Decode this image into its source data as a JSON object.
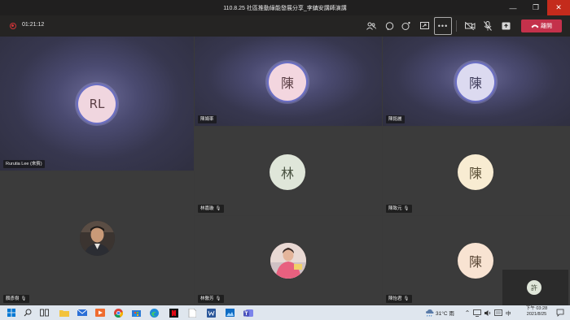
{
  "window": {
    "title": "110.8.25 社區推動綠能發展分享_李鎮安講師演講",
    "minimize": "—",
    "maximize": "❐",
    "close": "✕"
  },
  "toolbar": {
    "recording_time": "01:21:12",
    "leave_label": "離開",
    "icons": [
      "people-icon",
      "chat-icon",
      "reactions-icon",
      "share-screen-icon",
      "more-icon",
      "camera-off-icon",
      "mic-off-icon",
      "share-tray-icon",
      "phone-icon"
    ],
    "leave_color": "#c4314b"
  },
  "participants": [
    {
      "id": "rurutia",
      "name": "Rurutia Lee (來賓)",
      "initials": "RL",
      "avatar_bg": "#f0d6df",
      "text_color": "#5b3f45",
      "ring": true,
      "glow": true,
      "muted": false
    },
    {
      "id": "chen1",
      "name": "陳娟峯",
      "initials": "陳",
      "avatar_bg": "#f3d6df",
      "text_color": "#5b3f45",
      "ring": true,
      "glow": true,
      "muted": false
    },
    {
      "id": "chen2",
      "name": "陳銘麗",
      "initials": "陳",
      "avatar_bg": "#dcdaf0",
      "text_color": "#3f3d5b",
      "ring": true,
      "glow": true,
      "muted": false
    },
    {
      "id": "lin",
      "name": "林嘉璇",
      "initials": "林",
      "avatar_bg": "#dfe6d9",
      "text_color": "#47503f",
      "ring": false,
      "glow": false,
      "muted": true
    },
    {
      "id": "chen3",
      "name": "陳致元",
      "initials": "陳",
      "avatar_bg": "#f8ecd2",
      "text_color": "#5a4f36",
      "ring": false,
      "glow": false,
      "muted": true
    },
    {
      "id": "yan",
      "name": "顏彥樹",
      "initials": "",
      "avatar_bg": "#2a2a2a",
      "text_color": "#fff",
      "ring": false,
      "glow": false,
      "muted": true
    },
    {
      "id": "lin2",
      "name": "林醫芳",
      "initials": "",
      "avatar_bg": "#d9a6b0",
      "text_color": "#fff",
      "ring": false,
      "glow": false,
      "muted": true
    },
    {
      "id": "chen4",
      "name": "陳怡君",
      "initials": "陳",
      "avatar_bg": "#f8e3d2",
      "text_color": "#5a4736",
      "ring": false,
      "glow": false,
      "muted": true
    }
  ],
  "self_view": {
    "initials": "許",
    "avatar_bg": "#dfe6d9"
  },
  "taskbar": {
    "icons": [
      "windows-start-icon",
      "search-icon",
      "task-view-icon",
      "folder-icon",
      "mail-icon",
      "media-icon",
      "chrome-icon",
      "store-icon",
      "edge-icon",
      "netflix-icon",
      "word-icon",
      "photos-icon",
      "teams-icon"
    ],
    "weather": "31°C 雨",
    "ime": "中",
    "time": "下午 03:28",
    "date": "2021/8/25"
  }
}
